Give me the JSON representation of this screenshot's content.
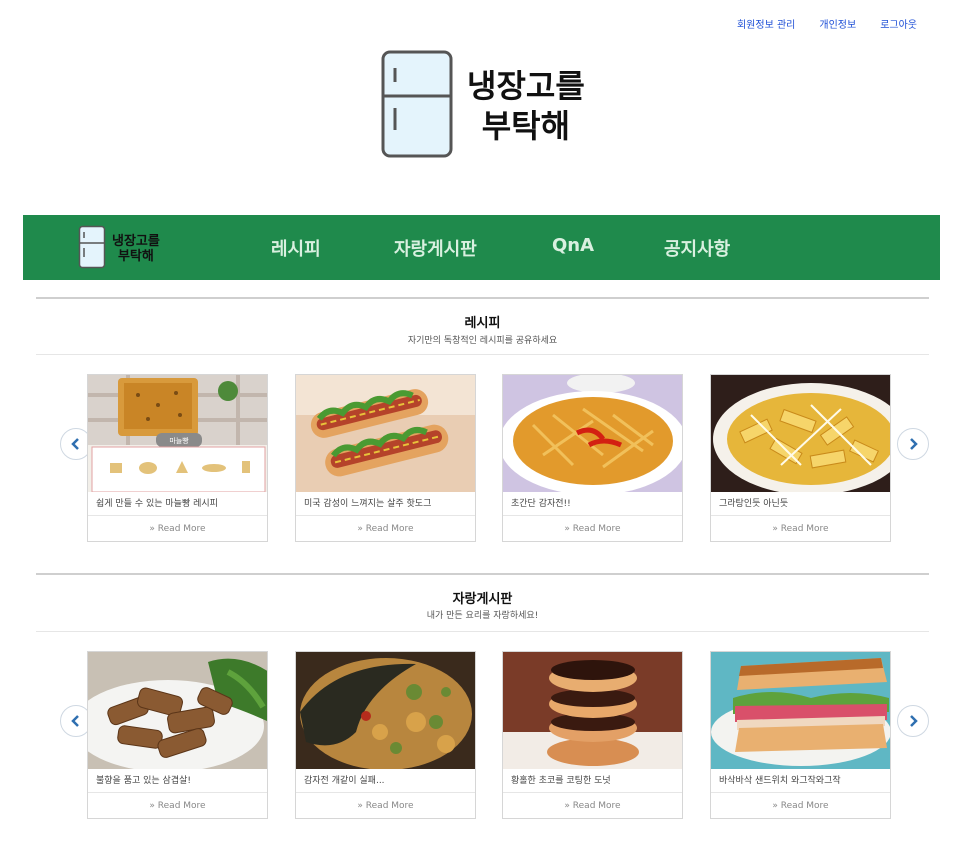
{
  "top_links": [
    "회원정보 관리",
    "개인정보",
    "로그아웃"
  ],
  "brand": {
    "line1": "냉장고를",
    "line2": "부탁해"
  },
  "nav": {
    "items": [
      "레시피",
      "자랑게시판",
      "QnA",
      "공지사항"
    ]
  },
  "sections": [
    {
      "title": "레시피",
      "subtitle": "자기만의 독창적인 레시피를 공유하세요",
      "read_more": "» Read More",
      "cards": [
        {
          "caption": "쉽게 만들 수 있는 마늘빵 레시피",
          "badge": "마늘빵"
        },
        {
          "caption": "미국 감성이 느껴지는 살주 핫도그"
        },
        {
          "caption": "초간단 감자전!!"
        },
        {
          "caption": "그라탕인듯 아닌듯"
        }
      ]
    },
    {
      "title": "자랑게시판",
      "subtitle": "내가 만든 요리를 자랑하세요!",
      "read_more": "» Read More",
      "cards": [
        {
          "caption": "불향을 품고 있는 삼겹살!"
        },
        {
          "caption": "감자전 개같이 실패..."
        },
        {
          "caption": "황홀한 초코를 코팅한 도넛"
        },
        {
          "caption": "바삭바삭 샌드위치 와그작와그작"
        }
      ]
    }
  ],
  "colors": {
    "nav_bg": "#1f8a4c",
    "link": "#1e4fd6"
  }
}
